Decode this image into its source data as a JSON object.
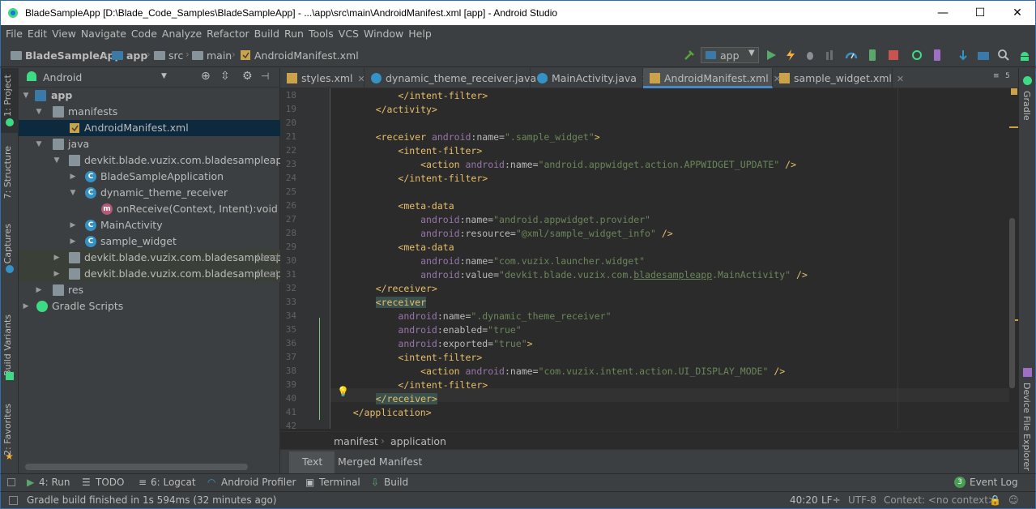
{
  "window": {
    "title": "BladeSampleApp [D:\\Blade_Code_Samples\\BladeSampleApp] - ...\\app\\src\\main\\AndroidManifest.xml [app] - Android Studio",
    "minimize": "—",
    "maximize": "☐",
    "close": "✕"
  },
  "menu": [
    "File",
    "Edit",
    "View",
    "Navigate",
    "Code",
    "Analyze",
    "Refactor",
    "Build",
    "Run",
    "Tools",
    "VCS",
    "Window",
    "Help"
  ],
  "breadcrumbs": [
    "BladeSampleApp",
    "app",
    "src",
    "main",
    "AndroidManifest.xml"
  ],
  "toolbar": {
    "run_config": "app"
  },
  "sidebar_left": {
    "project": "1: Project",
    "structure": "7: Structure",
    "captures": "Captures",
    "build_variants": "Build Variants",
    "favorites": "2: Favorites"
  },
  "sidebar_right": {
    "gradle": "Gradle",
    "device_explorer": "Device File Explorer"
  },
  "project": {
    "view": "Android",
    "tree": [
      {
        "label": "app",
        "bold": true
      },
      {
        "label": "manifests"
      },
      {
        "label": "AndroidManifest.xml"
      },
      {
        "label": "java"
      },
      {
        "label": "devkit.blade.vuzix.com.bladesampleapp"
      },
      {
        "label": "BladeSampleApplication"
      },
      {
        "label": "dynamic_theme_receiver"
      },
      {
        "label": "onReceive(Context, Intent):void"
      },
      {
        "label": "MainActivity"
      },
      {
        "label": "sample_widget"
      },
      {
        "label": "devkit.blade.vuzix.com.bladesampleapp",
        "suffix": "(andr"
      },
      {
        "label": "devkit.blade.vuzix.com.bladesampleapp",
        "suffix": "(test)"
      },
      {
        "label": "res"
      },
      {
        "label": "Gradle Scripts"
      }
    ]
  },
  "tabs": [
    "styles.xml",
    "dynamic_theme_receiver.java",
    "MainActivity.java",
    "AndroidManifest.xml",
    "sample_widget.xml"
  ],
  "tabs_overflow": "5",
  "editor": {
    "line_numbers": [
      "18",
      "19",
      "20",
      "21",
      "22",
      "23",
      "24",
      "25",
      "26",
      "27",
      "28",
      "29",
      "30",
      "31",
      "32",
      "33",
      "34",
      "35",
      "36",
      "37",
      "38",
      "39",
      "40",
      "41",
      "42"
    ],
    "breadcrumb": [
      "manifest",
      "application"
    ],
    "bottom_tabs": [
      "Text",
      "Merged Manifest"
    ]
  },
  "tool_windows": [
    "4: Run",
    "TODO",
    "6: Logcat",
    "Android Profiler",
    "Terminal",
    "Build"
  ],
  "event_log": {
    "count": "3",
    "label": "Event Log"
  },
  "status": {
    "message": "Gradle build finished in 1s 594ms (32 minutes ago)",
    "position": "40:20",
    "line_sep": "LF÷",
    "encoding": "UTF-8",
    "context": "Context: <no context>"
  },
  "colors": {
    "tag": "#e8bf6a",
    "attr_ns": "#9876aa",
    "value": "#6a8759",
    "selection": "#0d293e",
    "accent": "#4a88c7"
  }
}
